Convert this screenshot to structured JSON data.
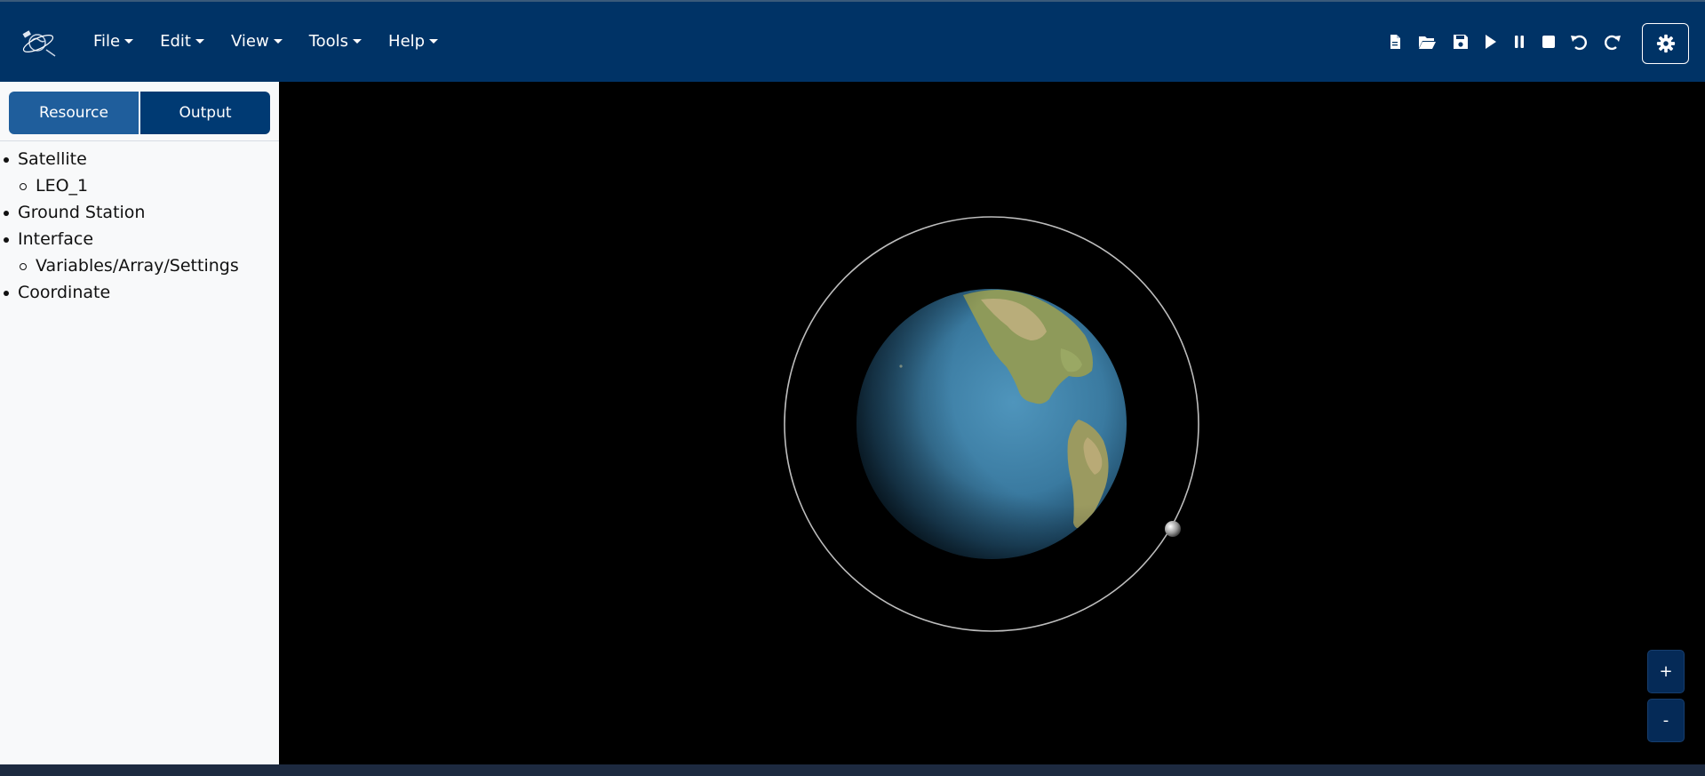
{
  "navbar": {
    "menus": [
      {
        "label": "File"
      },
      {
        "label": "Edit"
      },
      {
        "label": "View"
      },
      {
        "label": "Tools"
      },
      {
        "label": "Help"
      }
    ],
    "toolbar_icons": [
      "new-file-icon",
      "open-folder-icon",
      "save-icon",
      "play-icon",
      "pause-icon",
      "stop-icon",
      "undo-icon",
      "redo-icon"
    ],
    "settings_icon": "gear-icon",
    "background_color": "#003366"
  },
  "sidebar": {
    "tabs": [
      {
        "label": "Resource",
        "active": true
      },
      {
        "label": "Output",
        "active": false
      }
    ],
    "tree": [
      {
        "label": "Satellite",
        "children": [
          {
            "label": "LEO_1"
          }
        ]
      },
      {
        "label": "Ground Station",
        "children": []
      },
      {
        "label": "Interface",
        "children": [
          {
            "label": "Variables/Array/Settings"
          }
        ]
      },
      {
        "label": "Coordinate",
        "children": []
      }
    ]
  },
  "viewport": {
    "zoom_in_label": "+",
    "zoom_out_label": "-",
    "background_color": "#000000"
  }
}
